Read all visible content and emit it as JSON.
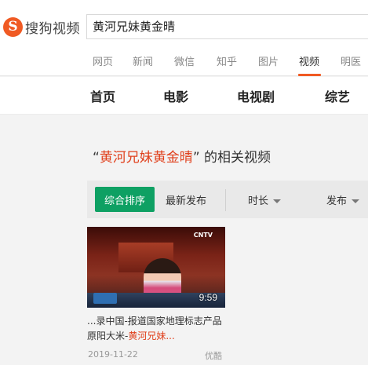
{
  "logo": {
    "mark": "S",
    "text": "搜狗视频"
  },
  "search": {
    "query": "黄河兄妹黄金晴"
  },
  "nav": {
    "items": [
      "网页",
      "新闻",
      "微信",
      "知乎",
      "图片",
      "视频",
      "明医"
    ],
    "active": "视频"
  },
  "categories": [
    "首页",
    "电影",
    "电视剧",
    "综艺"
  ],
  "results_title": {
    "open_quote": "“",
    "keyword": "黄河兄妹黄金晴",
    "close_quote": "”",
    "suffix": "的相关视频"
  },
  "filters": {
    "active": "综合排序",
    "latest": "最新发布",
    "duration": "时长",
    "publish": "发布"
  },
  "video": {
    "duration": "9:59",
    "title_prefix": "...录中国-报道国家地理标志产品原阳大米-",
    "title_highlight": "黄河兄妹...",
    "date": "2019-11-22",
    "source": "优酷",
    "thumb_channel": "CNTV"
  },
  "colors": {
    "accent": "#f05a23",
    "highlight": "#e0401c",
    "active_filter": "#0ea063"
  }
}
